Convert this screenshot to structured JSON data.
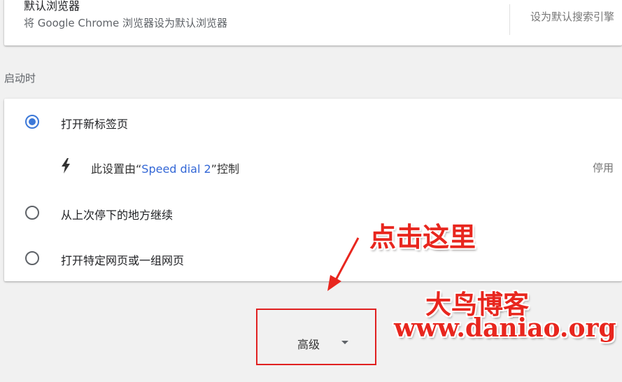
{
  "default_browser": {
    "title": "默认浏览器",
    "description": "将 Google Chrome 浏览器设为默认浏览器",
    "search_engine_text": "设为默认搜索引擎"
  },
  "startup": {
    "section_label": "启动时",
    "options": [
      {
        "label": "打开新标签页",
        "checked": true
      },
      {
        "label": "从上次停下的地方继续",
        "checked": false
      },
      {
        "label": "打开特定网页或一组网页",
        "checked": false
      }
    ],
    "controlled": {
      "prefix": "此设置由“",
      "extension": "Speed dial 2",
      "suffix": "”控制",
      "disable_label": "停用"
    }
  },
  "advanced": {
    "label": "高级"
  },
  "annotations": {
    "click_here": "点击这里",
    "brand": "大鸟博客",
    "site": "www.daniao.org",
    "color": "#e8261e"
  },
  "colors": {
    "accent": "#3c78d8",
    "link": "#3367d6",
    "highlight_box": "#e02020"
  }
}
